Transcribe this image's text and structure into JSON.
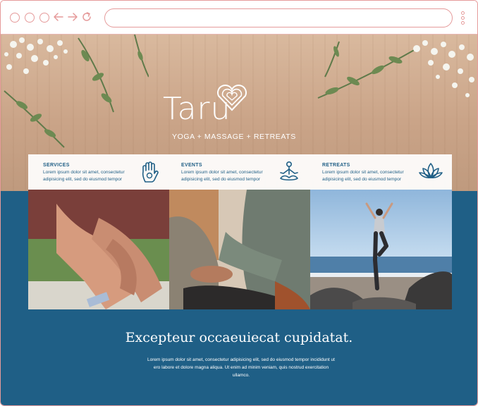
{
  "browser": {
    "url": "",
    "icons": [
      "circle-dot-icon",
      "back-arrow-icon",
      "forward-arrow-icon",
      "reload-icon",
      "kebab-menu-icon"
    ]
  },
  "hero": {
    "logo": "Taru",
    "tagline": "YOGA + MASSAGE + RETREATS"
  },
  "cards": [
    {
      "title": "SERVICES",
      "description": "Lorem ipsum dolor sit amet, consectetur adipisicing elit, sed do eiusmod tempor",
      "icon": "hand-icon"
    },
    {
      "title": "EVENTS",
      "description": "Lorem ipsum dolor sit amet, consectetur adipisicing elit, sed do eiusmod tempor",
      "icon": "meditation-icon"
    },
    {
      "title": "RETREATS",
      "description": "Lorem ipsum dolor sit amet, consectetur adipisicing elit, sed do eiusmod tempor",
      "icon": "lotus-icon"
    }
  ],
  "section": {
    "headline": "Excepteur occaeuiecat cupidatat.",
    "body": "Lorem ipsum dolor sit amet, consectetur adipisicing elit, sed do eiusmod tempor incididunt ut ero labore et dolore magna aliqua. Ut enim ad minim veniam, quis nostrud exercitation ullamco."
  },
  "colors": {
    "brand_blue": "#1f5f86",
    "chrome_accent": "#e59a9a",
    "wood": "#caa488"
  }
}
